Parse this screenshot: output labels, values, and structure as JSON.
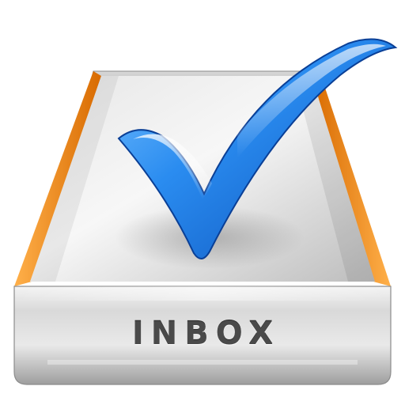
{
  "icon": {
    "label": "INBOX",
    "tray_icon": "inbox-tray-icon",
    "mark_icon": "checkmark-icon"
  },
  "colors": {
    "tray_edge": "#f08a1c",
    "tray_metal": "#c9c9c9",
    "check_blue": "#1f7fe0",
    "label_text": "#4a4a4a"
  }
}
